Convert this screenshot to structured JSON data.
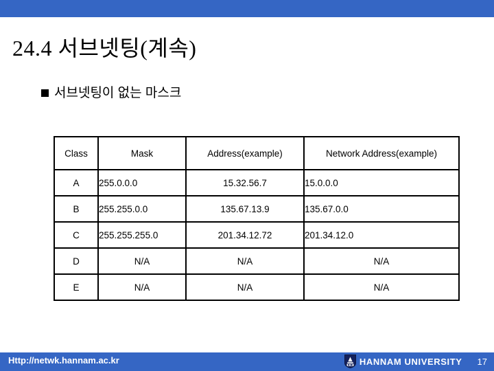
{
  "theme": {
    "accent_color": "#3566c4",
    "text_color": "#000000",
    "footer_text_color": "#ffffff"
  },
  "slide": {
    "title": "24.4 서브넷팅(계속)",
    "bullet": "서브넷팅이 없는 마스크"
  },
  "table": {
    "headers": [
      "Class",
      "Mask",
      "Address(example)",
      "Network Address(example)"
    ],
    "rows": [
      {
        "class": "A",
        "mask": "255.0.0.0",
        "address": "15.32.56.7",
        "network": "15.0.0.0"
      },
      {
        "class": "B",
        "mask": "255.255.0.0",
        "address": "135.67.13.9",
        "network": "135.67.0.0"
      },
      {
        "class": "C",
        "mask": "255.255.255.0",
        "address": "201.34.12.72",
        "network": "201.34.12.0"
      },
      {
        "class": "D",
        "mask": "N/A",
        "address": "N/A",
        "network": "N/A"
      },
      {
        "class": "E",
        "mask": "N/A",
        "address": "N/A",
        "network": "N/A"
      }
    ]
  },
  "footer": {
    "url": "Http://netwk.hannam.ac.kr",
    "university": "HANNAM UNIVERSITY",
    "logo_icon": "university-shield-icon",
    "page_number": "17"
  }
}
